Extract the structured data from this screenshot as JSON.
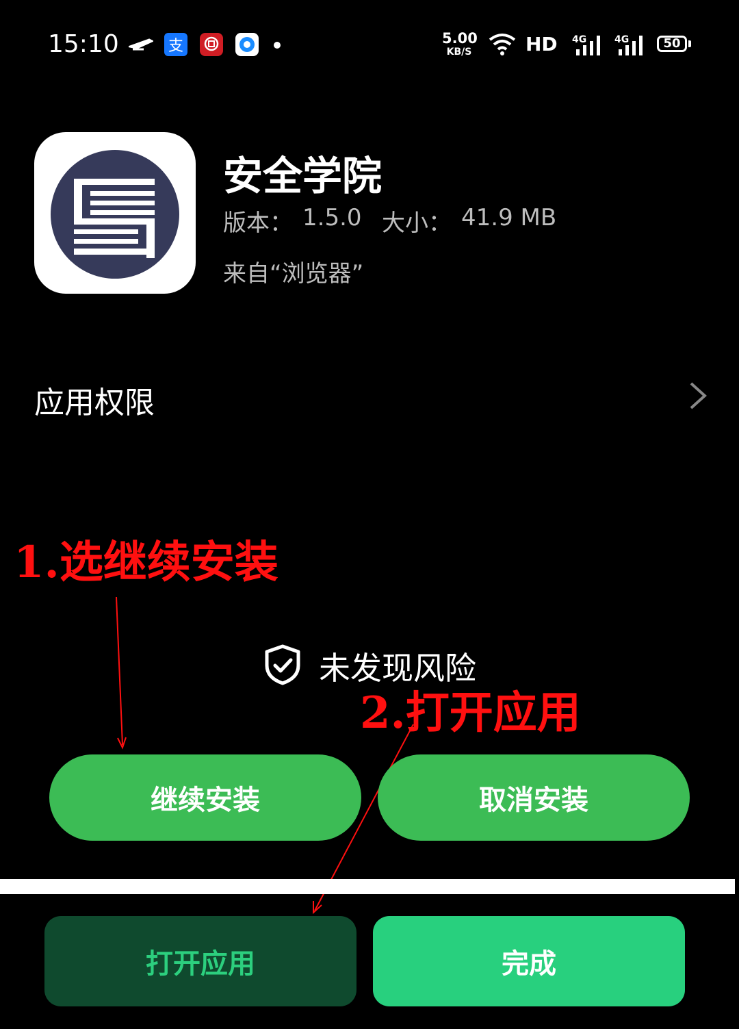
{
  "status_bar": {
    "time": "15:10",
    "net_speed_value": "5.00",
    "net_speed_unit": "KB/S",
    "hd": "HD",
    "signal1": "4G",
    "signal2": "4G",
    "battery": "50",
    "notification_icons": [
      "airplane-logo-icon",
      "alipay-icon",
      "bank-app-icon",
      "browser-app-icon"
    ]
  },
  "app": {
    "title": "安全学院",
    "version_label": "版本：",
    "version": "1.5.0",
    "size_label": "大小：",
    "size": "41.9 MB",
    "source": "来自“浏览器”"
  },
  "permissions": {
    "label": "应用权限"
  },
  "annotations": {
    "step1": "1.选继续安装",
    "step2": "2.打开应用",
    "color": "#ff1010"
  },
  "safety": {
    "text": "未发现风险"
  },
  "buttons": {
    "continue_install": "继续安装",
    "cancel_install": "取消安装",
    "open_app": "打开应用",
    "done": "完成"
  },
  "colors": {
    "primary_green": "#3cbc55",
    "open_button_bg": "#0f4a2e",
    "open_button_text": "#2ccf7e",
    "done_button_bg": "#28d07e",
    "app_icon_circle": "#363a5a"
  }
}
